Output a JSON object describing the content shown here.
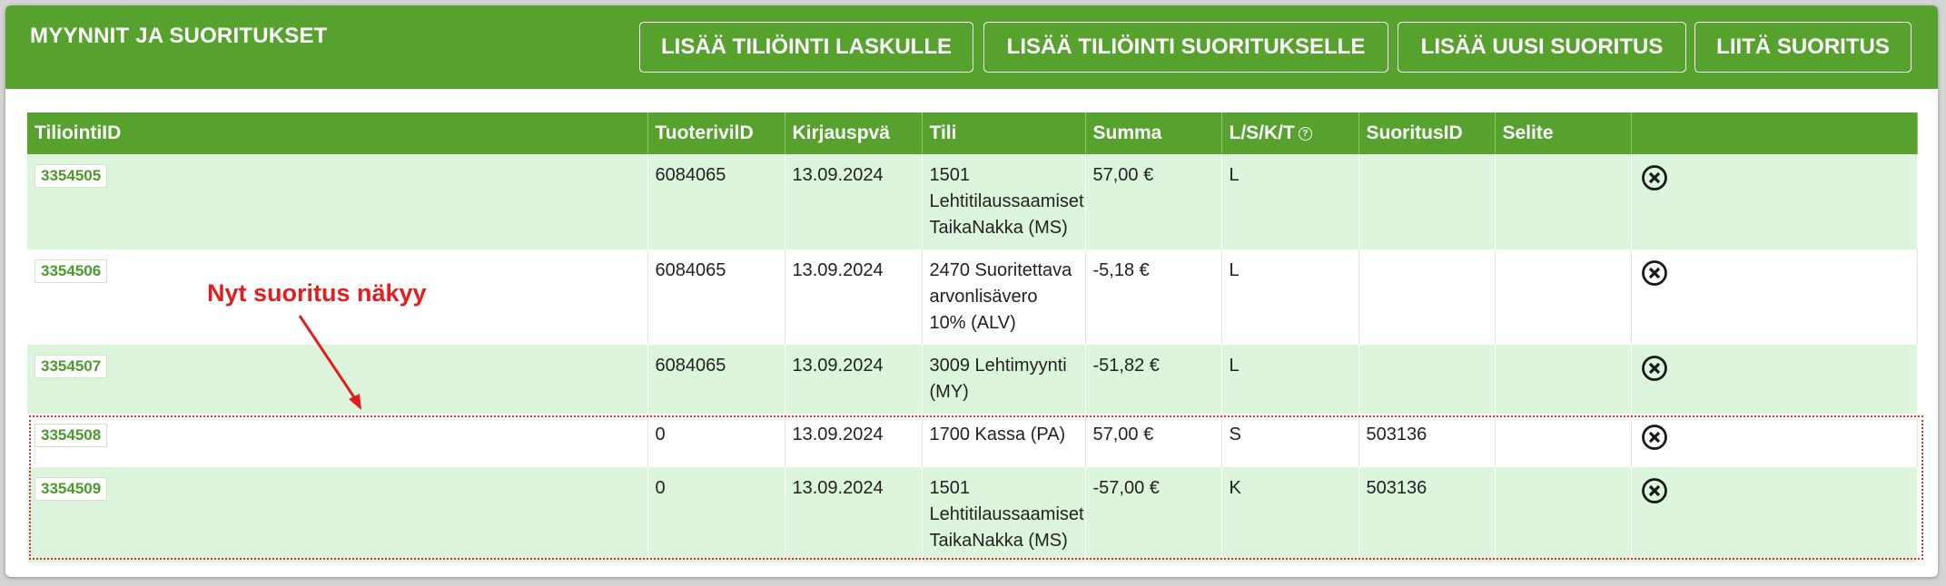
{
  "header": {
    "title": "MYYNNIT JA SUORITUKSET",
    "buttons": {
      "add_invoice_entry": "LISÄÄ TILIÖINTI LASKULLE",
      "add_payment_entry": "LISÄÄ TILIÖINTI SUORITUKSELLE",
      "add_new_payment": "LISÄÄ UUSI SUORITUS",
      "attach_payment": "LIITÄ SUORITUS"
    }
  },
  "table": {
    "columns": [
      "TiliointiID",
      "TuoterivilD",
      "Kirjauspvä",
      "Tili",
      "Summa",
      "L/S/K/T",
      "SuoritusID",
      "Selite",
      ""
    ],
    "rows": [
      {
        "id": "3354505",
        "tuoterivi": "6084065",
        "date": "13.09.2024",
        "tili": "1501 Lehtitilaussaamiset TaikaNakka (MS)",
        "summa": "57,00 €",
        "lskt": "L",
        "suoritus": "",
        "selite": ""
      },
      {
        "id": "3354506",
        "tuoterivi": "6084065",
        "date": "13.09.2024",
        "tili": "2470 Suoritettava arvonlisävero 10% (ALV)",
        "summa": "-5,18 €",
        "lskt": "L",
        "suoritus": "",
        "selite": ""
      },
      {
        "id": "3354507",
        "tuoterivi": "6084065",
        "date": "13.09.2024",
        "tili": "3009 Lehtimyynti (MY)",
        "summa": "-51,82 €",
        "lskt": "L",
        "suoritus": "",
        "selite": ""
      },
      {
        "id": "3354508",
        "tuoterivi": "0",
        "date": "13.09.2024",
        "tili": "1700 Kassa (PA)",
        "summa": "57,00 €",
        "lskt": "S",
        "suoritus": "503136",
        "selite": ""
      },
      {
        "id": "3354509",
        "tuoterivi": "0",
        "date": "13.09.2024",
        "tili": "1501 Lehtitilaussaamiset TaikaNakka (MS)",
        "summa": "-57,00 €",
        "lskt": "K",
        "suoritus": "503136",
        "selite": ""
      }
    ]
  },
  "annotation": {
    "text": "Nyt suoritus näkyy",
    "color": "#e21e1e"
  },
  "colors": {
    "header_green": "#57a22f",
    "row_green": "#ddf5dc",
    "link_green": "#4b9a2a"
  },
  "icons": {
    "help": "question-circle-icon",
    "delete": "x-circle-icon"
  }
}
